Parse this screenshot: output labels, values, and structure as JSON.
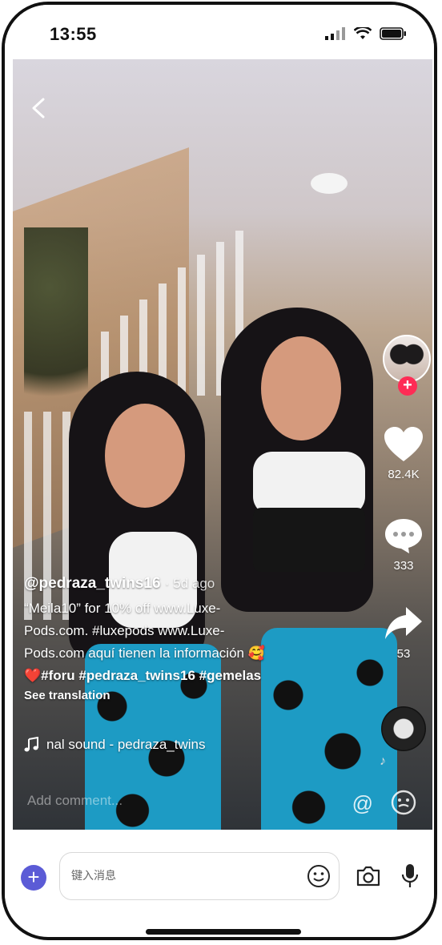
{
  "status_bar": {
    "time": "13:55"
  },
  "video": {
    "username": "@pedraza_twins16",
    "posted_ago": "· 5d ago",
    "caption_lines": [
      "“Meila10” for 10% off www.Luxe-",
      "Pods.com. #luxepods  www.Luxe-",
      "Pods.com aquí tienen la información 🥰",
      "❤️#foru #pedraza_twins16 #gemelas"
    ],
    "see_translation": "See translation",
    "sound": "nal sound - pedraza_twins"
  },
  "actions": {
    "likes": "82.4K",
    "comments": "333",
    "shares": "53",
    "follow_symbol": "+"
  },
  "comment_bar": {
    "placeholder": "Add comment...",
    "mention_symbol": "@"
  },
  "chat": {
    "add_symbol": "+",
    "input_placeholder": "键入消息"
  },
  "colors": {
    "follow_red": "#fe2c55",
    "plus_button": "#5b5bd6"
  },
  "icons": [
    "back-arrow-icon",
    "heart-icon",
    "comment-icon",
    "share-icon",
    "music-note-icon",
    "at-icon",
    "emoji-icon",
    "camera-icon",
    "microphone-icon",
    "wifi-icon",
    "signal-icon",
    "battery-icon"
  ]
}
